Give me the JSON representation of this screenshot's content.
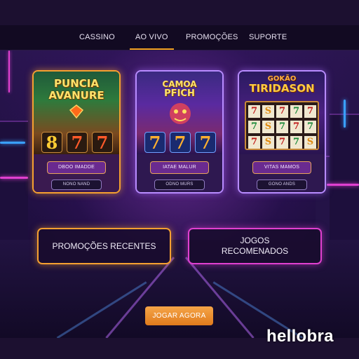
{
  "nav": {
    "items": [
      {
        "label": "CASSINO"
      },
      {
        "label": "AO VIVO",
        "active": true
      },
      {
        "label": "PROMOÇÕES"
      },
      {
        "label": "SUPORTE"
      }
    ]
  },
  "games": [
    {
      "title_line1": "PUNCIA",
      "title_line2": "AVANURE",
      "reels": [
        "8",
        "7",
        "7"
      ],
      "play_label": "DBOO IMADDE",
      "sub_label": "NONO NAND"
    },
    {
      "title_line1": "CAMOA",
      "title_line2": "PFICH",
      "reels": [
        "7",
        "7",
        "7"
      ],
      "play_label": "IATAE MALUR",
      "sub_label": "ODNO MURS"
    },
    {
      "title_line1": "GOKÃO",
      "title_line2": "TIRIDASON",
      "grid": [
        "7",
        "S",
        "7",
        "7",
        "7",
        "7",
        "S",
        "7",
        "7",
        "7",
        "7",
        "S",
        "7",
        "7",
        "S"
      ],
      "play_label": "VITAS MAMOS",
      "sub_label": "GONO ANDS"
    }
  ],
  "promos": {
    "recent": "PROMOÇÕES RECENTES",
    "recommended_line1": "JOGOS",
    "recommended_line2": "RECOMENADOS"
  },
  "cta": {
    "label": "JOGAR AGORA"
  },
  "watermark": "hellobra",
  "colors": {
    "accent_orange": "#f5a030",
    "accent_pink": "#e040d0",
    "accent_purple": "#b88cff",
    "nav_active_underline": "#f0a020"
  }
}
